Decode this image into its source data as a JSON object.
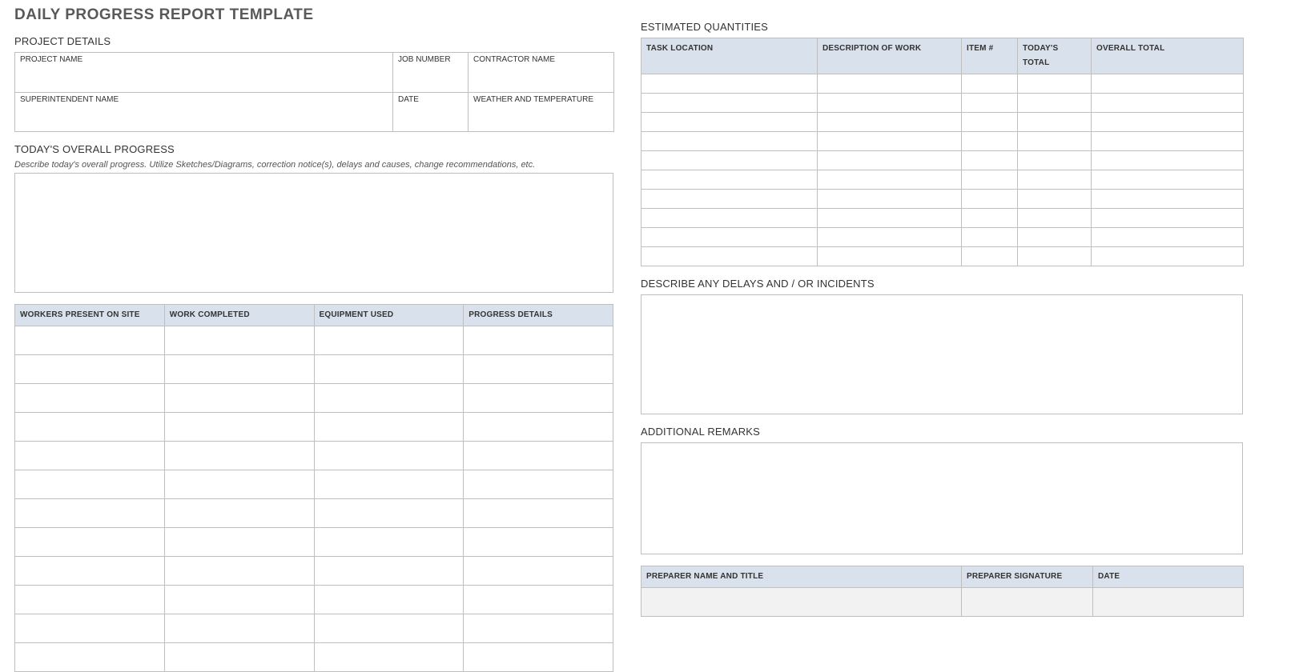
{
  "title": "DAILY PROGRESS REPORT TEMPLATE",
  "left": {
    "project_details": {
      "heading": "PROJECT DETAILS",
      "labels": {
        "project_name": "PROJECT NAME",
        "job_number": "JOB NUMBER",
        "contractor_name": "CONTRACTOR NAME",
        "superintendent_name": "SUPERINTENDENT NAME",
        "date": "DATE",
        "weather": "WEATHER AND TEMPERATURE"
      }
    },
    "overall_progress": {
      "heading": "TODAY'S OVERALL PROGRESS",
      "hint": "Describe today's overall progress.  Utilize Sketches/Diagrams, correction notice(s), delays and causes, change recommendations, etc."
    },
    "work_table": {
      "headers": [
        "WORKERS PRESENT ON SITE",
        "WORK COMPLETED",
        "EQUIPMENT USED",
        "PROGRESS DETAILS"
      ],
      "rows": 12
    }
  },
  "right": {
    "estimated_quantities": {
      "heading": "ESTIMATED QUANTITIES",
      "headers": [
        "TASK LOCATION",
        "DESCRIPTION OF WORK",
        "ITEM #",
        "TODAY'S TOTAL",
        "OVERALL TOTAL"
      ],
      "rows": 10
    },
    "delays": {
      "heading": "DESCRIBE ANY DELAYS AND / OR INCIDENTS"
    },
    "remarks": {
      "heading": "ADDITIONAL REMARKS"
    },
    "preparer": {
      "headers": [
        "PREPARER NAME AND TITLE",
        "PREPARER SIGNATURE",
        "DATE"
      ]
    }
  }
}
